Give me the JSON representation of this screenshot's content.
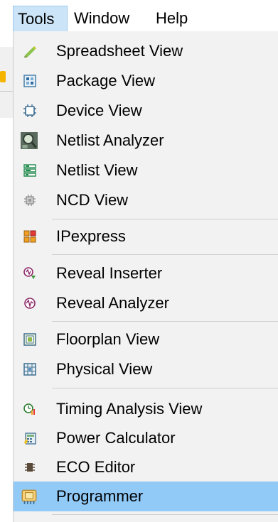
{
  "menubar": {
    "items": [
      {
        "label": "Tools",
        "active": true
      },
      {
        "label": "Window",
        "active": false
      },
      {
        "label": "Help",
        "active": false
      }
    ]
  },
  "menu": {
    "items": [
      {
        "label": "Spreadsheet View",
        "icon": "spreadsheet-icon"
      },
      {
        "label": "Package View",
        "icon": "package-icon"
      },
      {
        "label": "Device View",
        "icon": "chip-icon"
      },
      {
        "label": "Netlist Analyzer",
        "icon": "magnifier-icon"
      },
      {
        "label": "Netlist View",
        "icon": "netlist-icon"
      },
      {
        "label": "NCD View",
        "icon": "ncd-chip-icon"
      },
      {
        "label": "IPexpress",
        "icon": "ipexpress-icon"
      },
      {
        "label": "Reveal Inserter",
        "icon": "reveal-inserter-icon"
      },
      {
        "label": "Reveal Analyzer",
        "icon": "reveal-analyzer-icon"
      },
      {
        "label": "Floorplan View",
        "icon": "floorplan-icon"
      },
      {
        "label": "Physical View",
        "icon": "physical-icon"
      },
      {
        "label": "Timing Analysis View",
        "icon": "timing-icon"
      },
      {
        "label": "Power Calculator",
        "icon": "power-calculator-icon"
      },
      {
        "label": "ECO Editor",
        "icon": "eco-editor-icon"
      },
      {
        "label": "Programmer",
        "icon": "programmer-icon",
        "highlighted": true
      }
    ]
  },
  "colors": {
    "highlight": "#91c9f7",
    "menu_background": "#f2f2f2",
    "active_menubar": "#cce4f7"
  }
}
